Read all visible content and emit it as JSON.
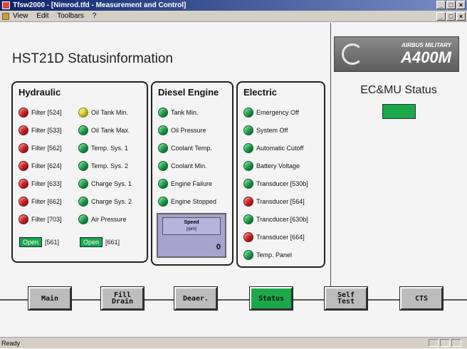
{
  "window": {
    "title": "Tfsw2000 - [Nimrod.tfd - Measurement and Control]"
  },
  "menu": [
    "View",
    "Edit",
    "Toolbars",
    "?"
  ],
  "page": {
    "title": "HST21D Statusinformation"
  },
  "logo": {
    "top": "AIRBUS MILITARY",
    "main": "A400M"
  },
  "ecmu": {
    "title": "EC&MU Status",
    "status_color": "#1aa84a"
  },
  "hydraulic": {
    "title": "Hydraulic",
    "col1": [
      {
        "label": "Filter [524]",
        "color": "#d62020"
      },
      {
        "label": "Filter [533]",
        "color": "#d62020"
      },
      {
        "label": "Filter [562]",
        "color": "#d62020"
      },
      {
        "label": "Filter [624]",
        "color": "#d62020"
      },
      {
        "label": "Filter [633]",
        "color": "#d62020"
      },
      {
        "label": "Filter [662]",
        "color": "#d62020"
      },
      {
        "label": "Filter [703]",
        "color": "#d62020"
      }
    ],
    "col2": [
      {
        "label": "Oil Tank Min.",
        "color": "#ecdc2c"
      },
      {
        "label": "Oil Tank Max.",
        "color": "#1aa84a"
      },
      {
        "label": "Temp. Sys. 1",
        "color": "#1aa84a"
      },
      {
        "label": "Temp. Sys. 2",
        "color": "#1aa84a"
      },
      {
        "label": "Charge Sys. 1",
        "color": "#1aa84a"
      },
      {
        "label": "Charge Sys. 2",
        "color": "#1aa84a"
      },
      {
        "label": "Air Pressure",
        "color": "#1aa84a"
      }
    ],
    "open1": {
      "button": "Open",
      "label": "[561]"
    },
    "open2": {
      "button": "Open",
      "label": "[661]"
    }
  },
  "diesel": {
    "title": "Diesel Engine",
    "items": [
      {
        "label": "Tank Min.",
        "color": "#1aa84a"
      },
      {
        "label": "Oil Pressure",
        "color": "#1aa84a"
      },
      {
        "label": "Coolant Temp.",
        "color": "#1aa84a"
      },
      {
        "label": "Coolant Min.",
        "color": "#1aa84a"
      },
      {
        "label": "Engine Failure",
        "color": "#1aa84a"
      },
      {
        "label": "Engine Stopped",
        "color": "#1aa84a"
      }
    ],
    "speed": {
      "label": "Speed",
      "unit": "[rpm]",
      "value": "0"
    }
  },
  "electric": {
    "title": "Electric",
    "items": [
      {
        "label": "Emergency Off",
        "color": "#1aa84a"
      },
      {
        "label": "System Off",
        "color": "#1aa84a"
      },
      {
        "label": "Automatic Cutoff",
        "color": "#1aa84a"
      },
      {
        "label": "Battery Voltage",
        "color": "#1aa84a"
      },
      {
        "label": "Transducer [530b]",
        "color": "#1aa84a"
      },
      {
        "label": "Transducer [564]",
        "color": "#d62020"
      },
      {
        "label": "Trancducer [630b]",
        "color": "#1aa84a"
      },
      {
        "label": "Transducer [664]",
        "color": "#d62020"
      },
      {
        "label": "Temp. Panel",
        "color": "#1aa84a"
      }
    ]
  },
  "toolbar": {
    "main": "Main",
    "fill_line1": "Fill",
    "fill_line2": "Drain",
    "deaer": "Deaer.",
    "status": "Status",
    "selftest_line1": "Self",
    "selftest_line2": "Test",
    "cts": "CTS"
  },
  "statusbar": {
    "text": "Ready"
  }
}
